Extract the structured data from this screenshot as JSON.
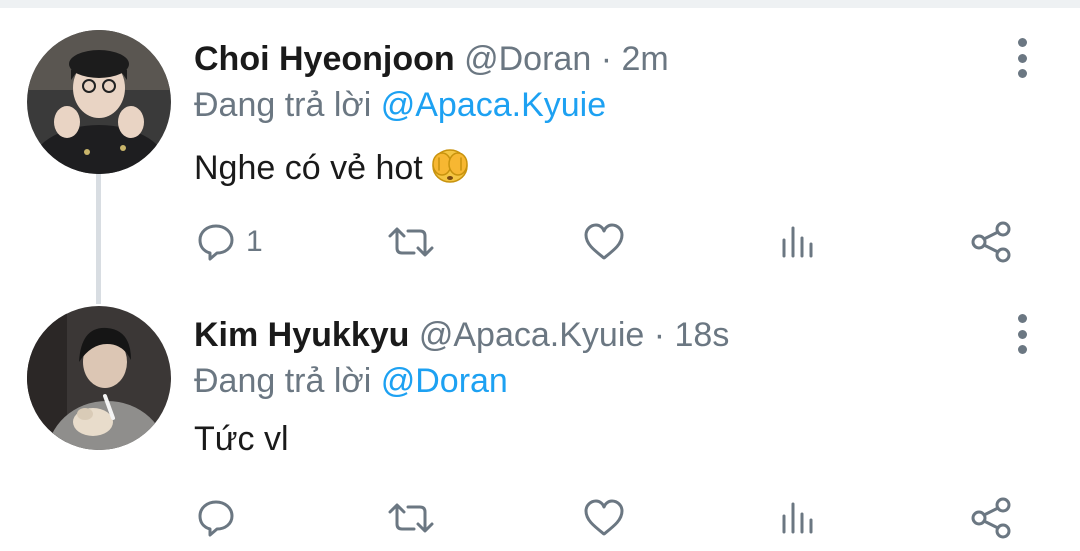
{
  "tweets": [
    {
      "name": "Choi Hyeonjoon",
      "handle": "@Doran",
      "separator": "·",
      "time": "2m",
      "replying_prefix": "Đang trả lời",
      "replying_to": "@Apaca.Kyuie",
      "text": "Nghe có vẻ hot",
      "emoji": "see-no-evil-monkey-icon",
      "reply_count": "1"
    },
    {
      "name": "Kim Hyukkyu",
      "handle": "@Apaca.Kyuie",
      "separator": "·",
      "time": "18s",
      "replying_prefix": "Đang trả lời",
      "replying_to": "@Doran",
      "text": "Tức vl",
      "reply_count": ""
    }
  ],
  "colors": {
    "mention": "#1da1f2",
    "muted": "#6b7782",
    "text": "#1a1a1a",
    "thread_line": "#d8dde2"
  }
}
